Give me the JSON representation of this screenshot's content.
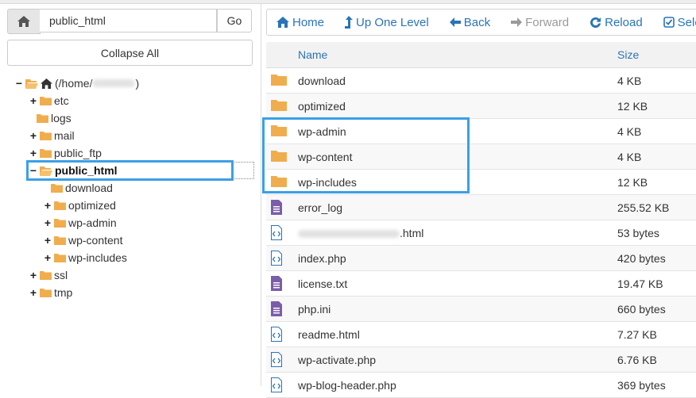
{
  "path_bar": {
    "value": "public_html",
    "go_label": "Go"
  },
  "collapse_label": "Collapse All",
  "tree": {
    "root_label": "(/home/",
    "root_suffix": ")",
    "items": [
      {
        "label": "etc",
        "toggle": "+"
      },
      {
        "label": "logs",
        "toggle": ""
      },
      {
        "label": "mail",
        "toggle": "+"
      },
      {
        "label": "public_ftp",
        "toggle": "+"
      },
      {
        "label": "public_html",
        "toggle": "−"
      },
      {
        "label": "download",
        "toggle": ""
      },
      {
        "label": "optimized",
        "toggle": "+"
      },
      {
        "label": "wp-admin",
        "toggle": "+"
      },
      {
        "label": "wp-content",
        "toggle": "+"
      },
      {
        "label": "wp-includes",
        "toggle": "+"
      },
      {
        "label": "ssl",
        "toggle": "+"
      },
      {
        "label": "tmp",
        "toggle": "+"
      }
    ]
  },
  "toolbar": {
    "home": "Home",
    "up": "Up One Level",
    "back": "Back",
    "forward": "Forward",
    "reload": "Reload",
    "select": "Select A"
  },
  "table": {
    "col_name": "Name",
    "col_size": "Size",
    "rows": [
      {
        "name": "download",
        "size": "4 KB",
        "type": "folder"
      },
      {
        "name": "optimized",
        "size": "12 KB",
        "type": "folder"
      },
      {
        "name": "wp-admin",
        "size": "4 KB",
        "type": "folder"
      },
      {
        "name": "wp-content",
        "size": "4 KB",
        "type": "folder"
      },
      {
        "name": "wp-includes",
        "size": "12 KB",
        "type": "folder"
      },
      {
        "name": "error_log",
        "size": "255.52 KB",
        "type": "text"
      },
      {
        "name": ".html",
        "size": "53 bytes",
        "type": "code"
      },
      {
        "name": "index.php",
        "size": "420 bytes",
        "type": "code"
      },
      {
        "name": "license.txt",
        "size": "19.47 KB",
        "type": "text"
      },
      {
        "name": "php.ini",
        "size": "660 bytes",
        "type": "text"
      },
      {
        "name": "readme.html",
        "size": "7.27 KB",
        "type": "code"
      },
      {
        "name": "wp-activate.php",
        "size": "6.76 KB",
        "type": "code"
      },
      {
        "name": "wp-blog-header.php",
        "size": "369 bytes",
        "type": "code"
      }
    ]
  },
  "colors": {
    "accent": "#2a74b7",
    "highlight": "#3aa0e6",
    "folder": "#f0ad4e",
    "doc": "#7a5da8"
  }
}
